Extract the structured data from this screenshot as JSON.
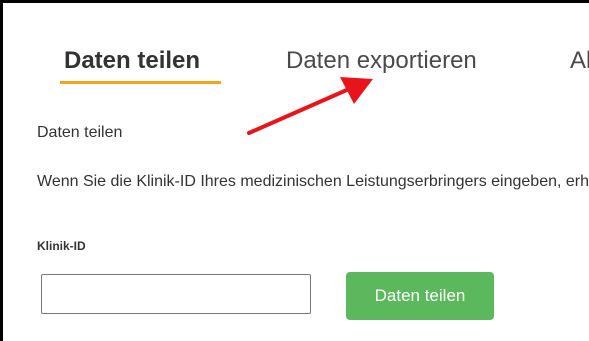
{
  "tabs": [
    {
      "label": "Daten teilen",
      "active": true
    },
    {
      "label": "Daten exportieren",
      "active": false
    },
    {
      "label": "Al",
      "active": false
    }
  ],
  "section": {
    "title": "Daten teilen",
    "description": "Wenn Sie die Klinik-ID Ihres medizinischen Leistungserbringers eingeben, erhalten."
  },
  "form": {
    "field_label": "Klinik-ID",
    "input_value": "",
    "input_placeholder": "",
    "submit_label": "Daten teilen"
  },
  "colors": {
    "tab_underline": "#f2a51a",
    "button": "#5cb85c",
    "annotation_arrow": "#e8141c"
  }
}
